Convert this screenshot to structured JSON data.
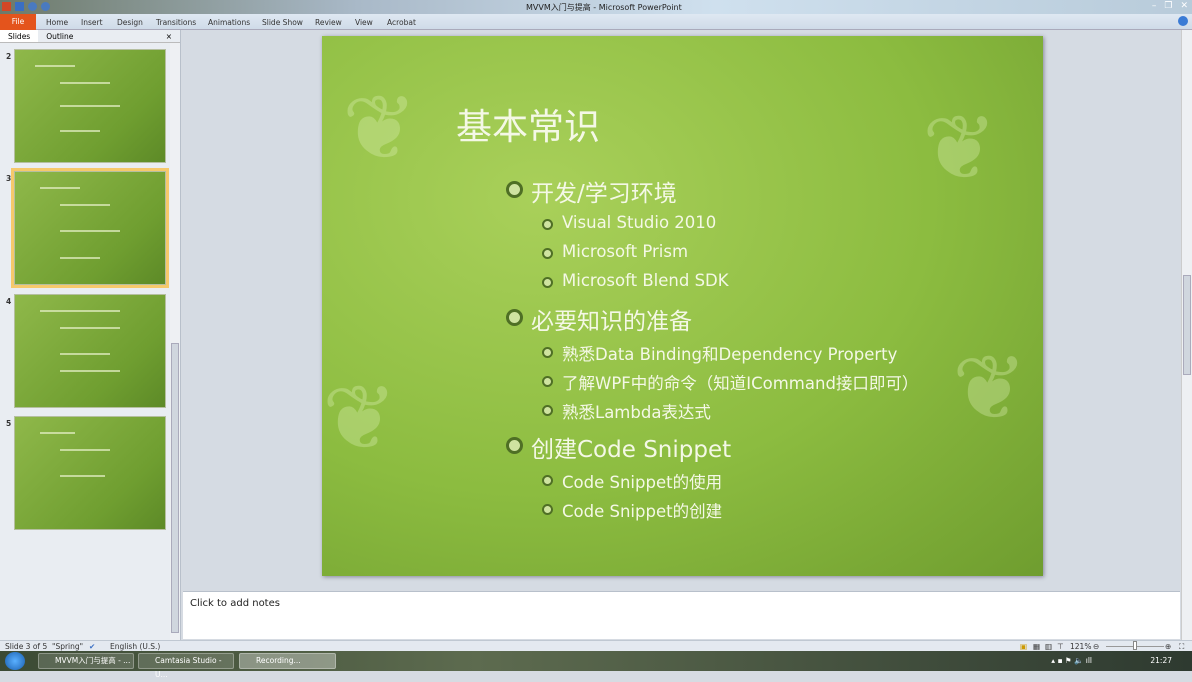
{
  "window": {
    "title": "MVVM入门与提高 - Microsoft PowerPoint"
  },
  "ribbon": {
    "tabs": [
      "File",
      "Home",
      "Insert",
      "Design",
      "Transitions",
      "Animations",
      "Slide Show",
      "Review",
      "View",
      "Acrobat"
    ]
  },
  "panel": {
    "tabs": [
      "Slides",
      "Outline"
    ],
    "close": "×",
    "thumbnails": [
      {
        "number": "2"
      },
      {
        "number": "3",
        "selected": true
      },
      {
        "number": "4"
      },
      {
        "number": "5"
      }
    ]
  },
  "slide": {
    "title": "基本常识",
    "sections": [
      {
        "heading": "开发/学习环境",
        "items": [
          "Visual Studio 2010",
          "Microsoft Prism",
          "Microsoft Blend SDK"
        ]
      },
      {
        "heading": "必要知识的准备",
        "items": [
          "熟悉Data Binding和Dependency Property",
          "了解WPF中的命令（知道ICommand接口即可）",
          "熟悉Lambda表达式"
        ]
      },
      {
        "heading": "创建Code Snippet",
        "items": [
          "Code Snippet的使用",
          "Code Snippet的创建"
        ]
      }
    ]
  },
  "notes": {
    "placeholder": "Click to add notes"
  },
  "status": {
    "slide": "Slide 3 of 5",
    "theme": "\"Spring\"",
    "language": "English (U.S.)",
    "zoom": "121%"
  },
  "taskbar": {
    "items": [
      "MVVM入门与提高 - ...",
      "Camtasia Studio - U...",
      "Recording..."
    ],
    "time": "21:27"
  }
}
